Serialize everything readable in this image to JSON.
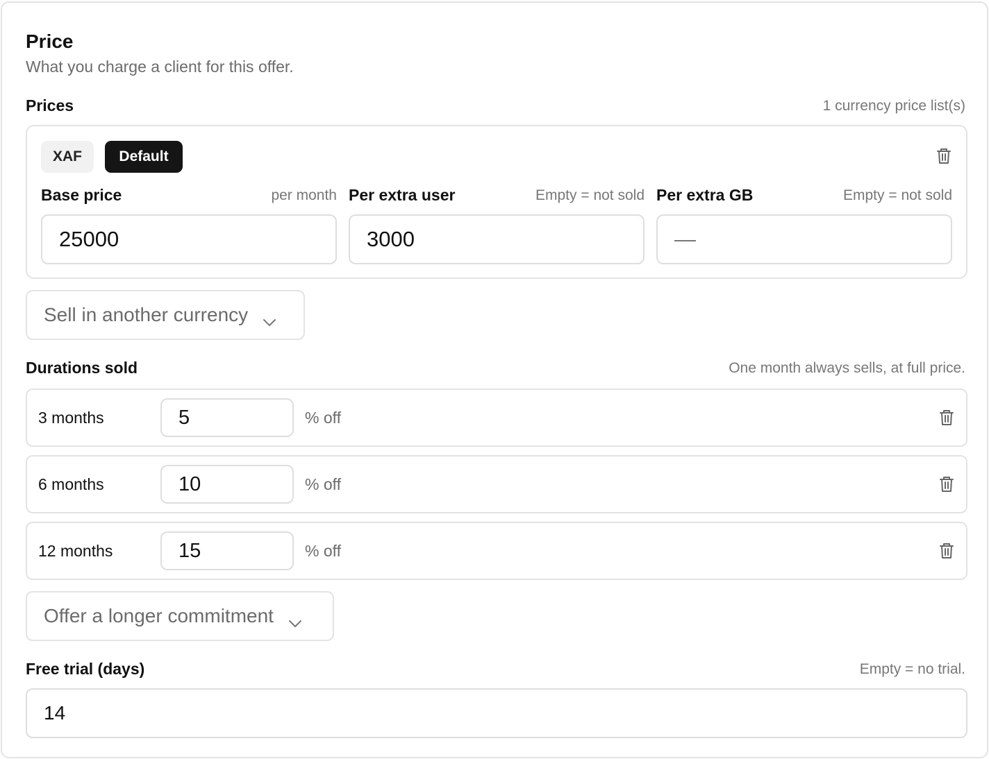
{
  "section": {
    "title": "Price",
    "subtitle": "What you charge a client for this offer."
  },
  "prices": {
    "label": "Prices",
    "count_hint": "1 currency price list(s)",
    "currency": "XAF",
    "default_badge": "Default",
    "fields": [
      {
        "label": "Base price",
        "hint": "per month",
        "value": "25000"
      },
      {
        "label": "Per extra user",
        "hint": "Empty = not sold",
        "value": "3000"
      },
      {
        "label": "Per extra GB",
        "hint": "Empty = not sold",
        "value": "—"
      }
    ],
    "add_currency_label": "Sell in another currency"
  },
  "durations": {
    "label": "Durations sold",
    "hint": "One month always sells, at full price.",
    "rows": [
      {
        "label": "3 months",
        "value": "5",
        "suffix": "% off"
      },
      {
        "label": "6 months",
        "value": "10",
        "suffix": "% off"
      },
      {
        "label": "12 months",
        "value": "15",
        "suffix": "% off"
      }
    ],
    "add_label": "Offer a longer commitment"
  },
  "trial": {
    "label": "Free trial (days)",
    "hint": "Empty = no trial.",
    "value": "14"
  },
  "icons": {
    "delete": "trash-icon",
    "expand": "chevron-down-icon"
  }
}
